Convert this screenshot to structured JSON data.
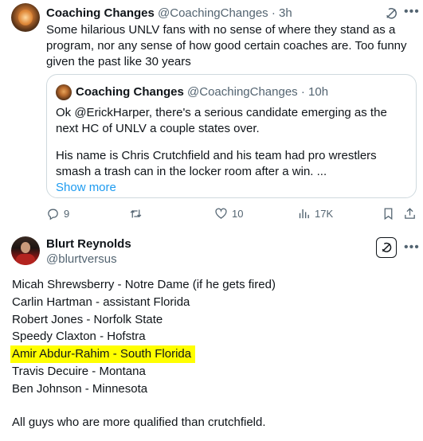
{
  "tweet1": {
    "display_name": "Coaching Changes",
    "handle": "@CoachingChanges",
    "separator": "·",
    "time": "3h",
    "text": "Some hilarious UNLV fans with no sense of where they stand as a program, nor any sense of how good certain coaches are.  Too funny given the past like 30 years",
    "quote": {
      "display_name": "Coaching Changes",
      "handle": "@CoachingChanges",
      "separator": "·",
      "time": "10h",
      "para1": "Ok @ErickHarper, there's a serious candidate emerging as the next HC of UNLV a couple states over.",
      "para2": "His name is Chris Crutchfield and his team had pro wrestlers smash a trash can in the locker room after a win.  ...",
      "show_more": "Show more"
    },
    "actions": {
      "replies": "9",
      "reposts": "",
      "likes": "10",
      "views": "17K"
    }
  },
  "tweet2": {
    "display_name": "Blurt Reynolds",
    "handle": "@blurtversus",
    "lines": [
      "Micah Shrewsberry - Notre Dame (if he gets fired)",
      "Carlin Hartman - assistant Florida",
      "Robert Jones - Norfolk State",
      "Speedy Claxton - Hofstra",
      "Amir Abdur-Rahim - South Florida",
      "Travis Decuire - Montana",
      "Ben Johnson - Minnesota"
    ],
    "highlighted_index": 4,
    "highlight_color": "#ffff00",
    "footer": "All guys who are more qualified than crutchfield."
  },
  "colors": {
    "text": "#0f1419",
    "muted": "#536471",
    "link": "#1d9bf0",
    "border": "#cfd9de"
  }
}
